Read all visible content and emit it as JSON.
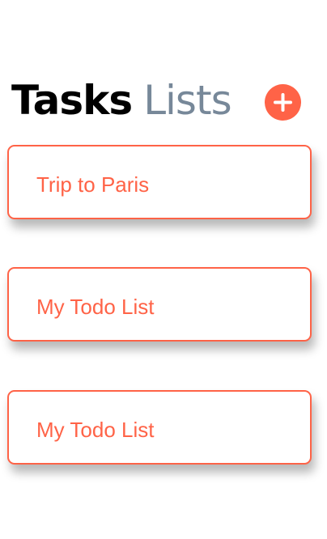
{
  "header": {
    "title_primary": "Tasks",
    "title_secondary": "Lists"
  },
  "add_button": {
    "icon": "plus-icon"
  },
  "lists": [
    {
      "label": "Trip to Paris"
    },
    {
      "label": "My Todo List"
    },
    {
      "label": "My Todo List"
    }
  ],
  "colors": {
    "accent": "#ff6347",
    "secondary_text": "#778899",
    "primary_text": "#000000"
  }
}
